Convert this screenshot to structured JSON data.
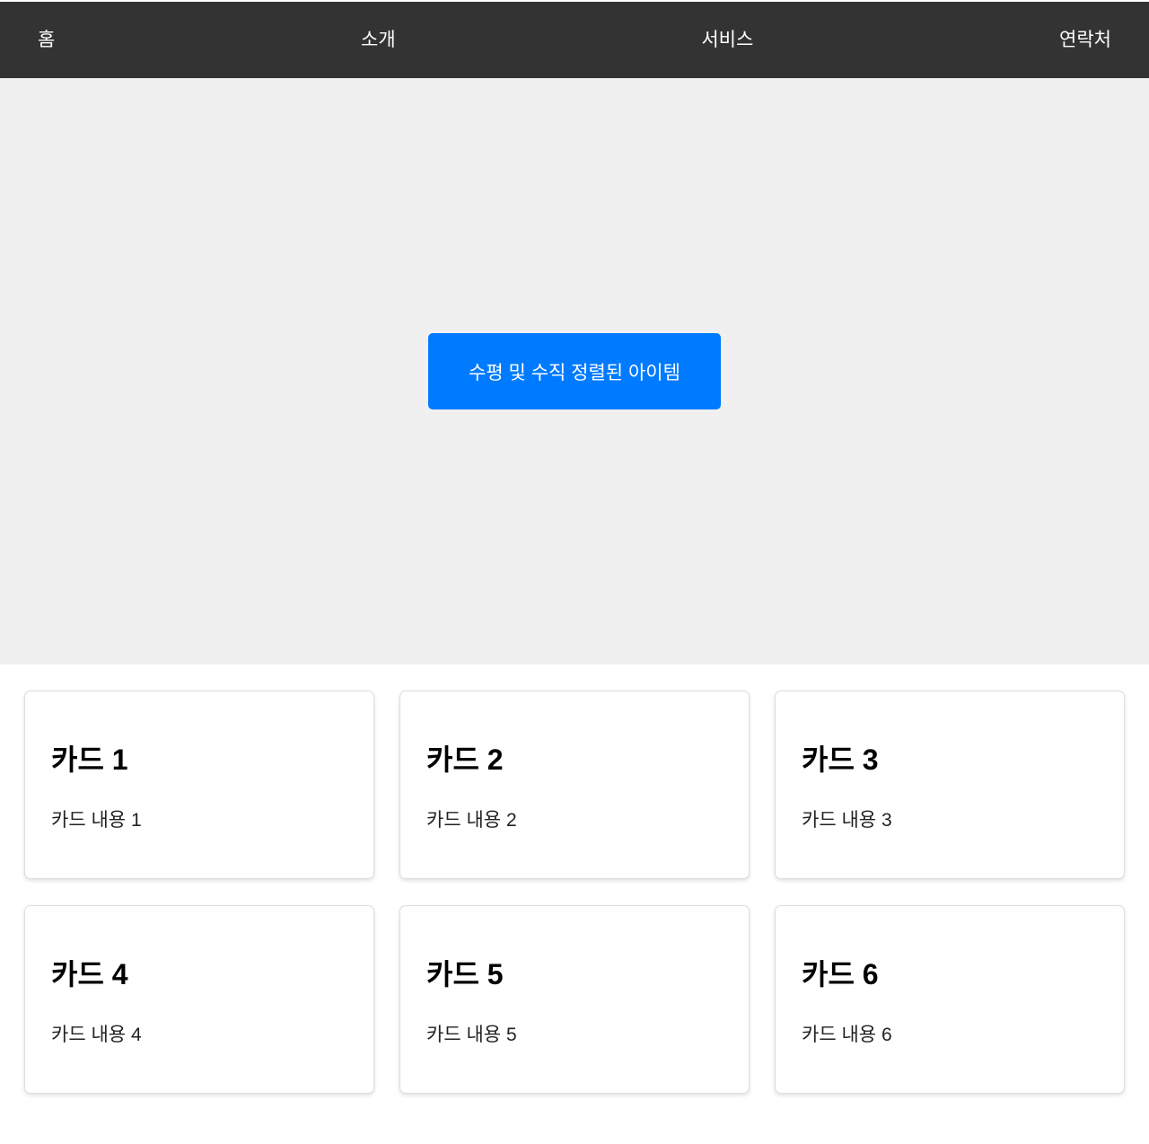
{
  "nav": {
    "items": [
      {
        "label": "홈"
      },
      {
        "label": "소개"
      },
      {
        "label": "서비스"
      },
      {
        "label": "연락처"
      }
    ]
  },
  "hero": {
    "button_label": "수평 및 수직 정렬된 아이템"
  },
  "cards": [
    {
      "title": "카드 1",
      "content": "카드 내용 1"
    },
    {
      "title": "카드 2",
      "content": "카드 내용 2"
    },
    {
      "title": "카드 3",
      "content": "카드 내용 3"
    },
    {
      "title": "카드 4",
      "content": "카드 내용 4"
    },
    {
      "title": "카드 5",
      "content": "카드 내용 5"
    },
    {
      "title": "카드 6",
      "content": "카드 내용 6"
    }
  ],
  "colors": {
    "navbar_bg": "#333333",
    "hero_bg": "#f0f0f0",
    "accent": "#007bff"
  }
}
